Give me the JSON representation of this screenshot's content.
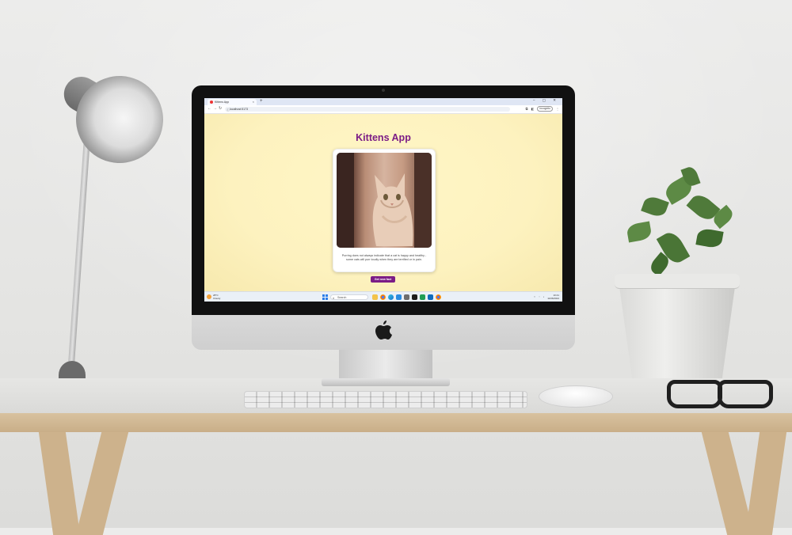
{
  "browser": {
    "tab_title": "Kittens App",
    "tab_close": "×",
    "new_tab": "+",
    "window_controls": "– ▢ ✕",
    "back": "←",
    "forward": "→",
    "reload": "↻",
    "url": "localhost:5173",
    "incognito_label": "Incognito"
  },
  "app": {
    "title": "Kittens App",
    "fact_text": "Purring does not always indicate that a cat is happy and healthy - some cats will purr loudly when they are terrified or in pain.",
    "button_label": "Get new fact",
    "accent_color": "#7b1c86",
    "background_color": "#fff8cc"
  },
  "taskbar": {
    "weather_temp": "28°C",
    "weather_desc": "Cloudy",
    "search_placeholder": "Search",
    "time": "10:41",
    "date": "11/06/2024",
    "pinned_icons": [
      "file-explorer-icon",
      "chrome-icon",
      "edge-icon",
      "vscode-icon",
      "settings-icon",
      "terminal-icon",
      "store-icon",
      "mail-icon",
      "chrome-icon"
    ]
  }
}
